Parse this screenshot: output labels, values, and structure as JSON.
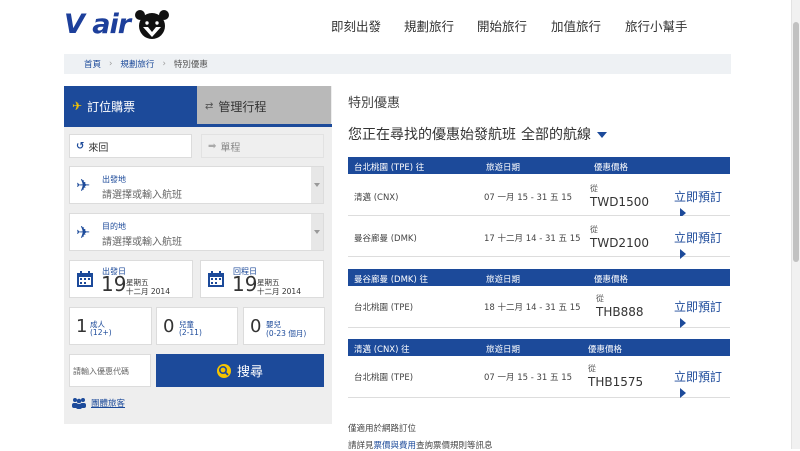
{
  "header": {
    "logo_text": "V air",
    "nav": [
      "即刻出發",
      "規劃旅行",
      "開始旅行",
      "加值旅行",
      "旅行小幫手"
    ]
  },
  "breadcrumb": [
    "首頁",
    "規劃旅行",
    "特別優惠"
  ],
  "booking": {
    "tab_book": "訂位購票",
    "tab_manage": "管理行程",
    "roundtrip": "來回",
    "oneway": "單程",
    "origin_label": "出發地",
    "origin_placeholder": "請選擇或輸入航班",
    "dest_label": "目的地",
    "dest_placeholder": "請選擇或輸入航班",
    "depart": {
      "label": "出發日",
      "day": "19",
      "weekday": "星期五",
      "monthyear": "十二月 2014"
    },
    "return": {
      "label": "回程日",
      "day": "19",
      "weekday": "星期五",
      "monthyear": "十二月 2014"
    },
    "adult": {
      "count": "1",
      "label": "成人",
      "note": "(12+)"
    },
    "child": {
      "count": "0",
      "label": "兒童",
      "note": "(2-11)"
    },
    "infant": {
      "count": "0",
      "label": "嬰兒",
      "note": "(0-23 個月)"
    },
    "promo_placeholder": "請輸入優惠代碼",
    "search_label": "搜尋",
    "group_link": "團體旅客"
  },
  "offers": {
    "title": "特別優惠",
    "subtitle": "您正在尋找的優惠始發航班",
    "filter": "全部的航線",
    "col_date": "旅遊日期",
    "col_price": "優惠價格",
    "from_label": "從",
    "book_label": "立即預訂",
    "groups": [
      {
        "origin": "台北桃園 (TPE) 往",
        "rows": [
          {
            "dest": "清邁 (CNX)",
            "dates": "07 一月 15 - 31 五 15",
            "price": "TWD1500"
          },
          {
            "dest": "曼谷廊曼 (DMK)",
            "dates": "17 十二月 14 - 31 五 15",
            "price": "TWD2100"
          }
        ]
      },
      {
        "origin": "曼谷廊曼 (DMK) 往",
        "rows": [
          {
            "dest": "台北桃園 (TPE)",
            "dates": "18 十二月 14 - 31 五 15",
            "price": "THB888"
          }
        ]
      },
      {
        "origin": "清邁 (CNX) 往",
        "rows": [
          {
            "dest": "台北桃園 (TPE)",
            "dates": "07 一月 15 - 31 五 15",
            "price": "THB1575"
          }
        ]
      }
    ],
    "note1": "僅適用於網路訂位",
    "note2_prefix": "請詳見",
    "note2_link": "票價與費用",
    "note2_suffix": "查詢票價規則等訊息"
  },
  "colors": {
    "brand": "#1c4a9a",
    "accent": "#f5c400"
  }
}
